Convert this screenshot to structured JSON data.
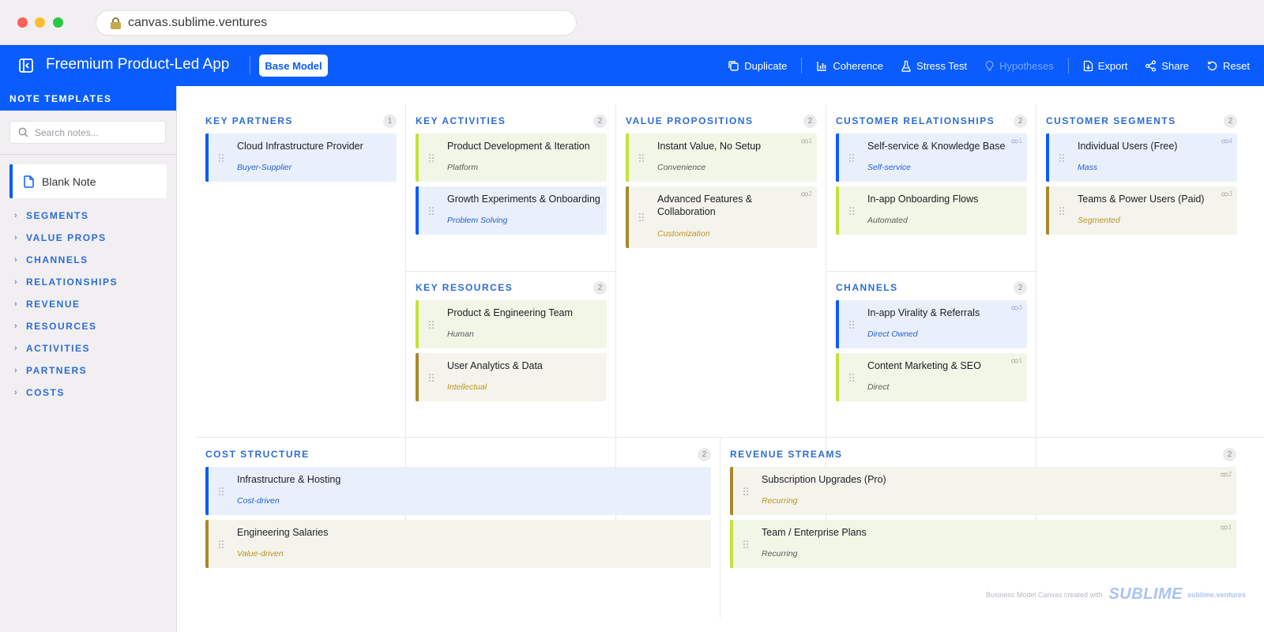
{
  "browser": {
    "url": "canvas.sublime.ventures"
  },
  "header": {
    "title": "Freemium Product-Led App",
    "model_button": "Base Model",
    "actions": [
      {
        "label": "Duplicate",
        "icon": "duplicate-icon",
        "enabled": true
      },
      {
        "label": "Coherence",
        "icon": "bar-chart-icon",
        "enabled": true
      },
      {
        "label": "Stress Test",
        "icon": "flask-icon",
        "enabled": true
      },
      {
        "label": "Hypotheses",
        "icon": "lightbulb-icon",
        "enabled": false
      },
      {
        "label": "Export",
        "icon": "export-icon",
        "enabled": true
      },
      {
        "label": "Share",
        "icon": "share-icon",
        "enabled": true
      },
      {
        "label": "Reset",
        "icon": "reset-icon",
        "enabled": true
      }
    ]
  },
  "sidebar": {
    "title": "NOTE TEMPLATES",
    "search_placeholder": "Search notes...",
    "blank_note": "Blank Note",
    "categories": [
      "SEGMENTS",
      "VALUE PROPS",
      "CHANNELS",
      "RELATIONSHIPS",
      "REVENUE",
      "RESOURCES",
      "ACTIVITIES",
      "PARTNERS",
      "COSTS"
    ]
  },
  "canvas": {
    "key_partners": {
      "title": "KEY PARTNERS",
      "count": "1",
      "notes": [
        {
          "title": "Cloud Infrastructure Provider",
          "tag": "Buyer-Supplier",
          "color": "blue",
          "links": ""
        }
      ]
    },
    "key_activities": {
      "title": "KEY ACTIVITIES",
      "count": "2",
      "notes": [
        {
          "title": "Product Development & Iteration",
          "tag": "Platform",
          "color": "lime",
          "links": ""
        },
        {
          "title": "Growth Experiments & Onboarding",
          "tag": "Problem Solving",
          "color": "blue",
          "links": ""
        }
      ]
    },
    "key_resources": {
      "title": "KEY RESOURCES",
      "count": "2",
      "notes": [
        {
          "title": "Product & Engineering Team",
          "tag": "Human",
          "color": "lime",
          "links": ""
        },
        {
          "title": "User Analytics & Data",
          "tag": "Intellectual",
          "color": "olive",
          "links": ""
        }
      ]
    },
    "value_propositions": {
      "title": "VALUE PROPOSITIONS",
      "count": "2",
      "notes": [
        {
          "title": "Instant Value, No Setup",
          "tag": "Convenience",
          "color": "lime",
          "links": "1"
        },
        {
          "title": "Advanced Features & Collaboration",
          "tag": "Customization",
          "color": "olive",
          "links": "2"
        }
      ]
    },
    "customer_relationships": {
      "title": "CUSTOMER RELATIONSHIPS",
      "count": "2",
      "notes": [
        {
          "title": "Self-service & Knowledge Base",
          "tag": "Self-service",
          "color": "blue",
          "links": "1"
        },
        {
          "title": "In-app Onboarding Flows",
          "tag": "Automated",
          "color": "lime",
          "links": ""
        }
      ]
    },
    "channels": {
      "title": "CHANNELS",
      "count": "2",
      "notes": [
        {
          "title": "In-app Virality & Referrals",
          "tag": "Direct Owned",
          "color": "blue",
          "links": "3"
        },
        {
          "title": "Content Marketing & SEO",
          "tag": "Direct",
          "color": "lime",
          "links": "1"
        }
      ]
    },
    "customer_segments": {
      "title": "CUSTOMER SEGMENTS",
      "count": "2",
      "notes": [
        {
          "title": "Individual Users (Free)",
          "tag": "Mass",
          "color": "blue",
          "links": "4"
        },
        {
          "title": "Teams & Power Users (Paid)",
          "tag": "Segmented",
          "color": "olive",
          "links": "3"
        }
      ]
    },
    "cost_structure": {
      "title": "COST STRUCTURE",
      "count": "2",
      "notes": [
        {
          "title": "Infrastructure & Hosting",
          "tag": "Cost-driven",
          "color": "blue",
          "links": ""
        },
        {
          "title": "Engineering Salaries",
          "tag": "Value-driven",
          "color": "olive",
          "links": ""
        }
      ]
    },
    "revenue_streams": {
      "title": "REVENUE STREAMS",
      "count": "2",
      "notes": [
        {
          "title": "Subscription Upgrades (Pro)",
          "tag": "Recurring",
          "color": "olive",
          "links": "2"
        },
        {
          "title": "Team / Enterprise Plans",
          "tag": "Recurring",
          "color": "lime",
          "links": "1"
        }
      ]
    }
  },
  "footer": {
    "made_with": "Business Model Canvas created with",
    "logo": "SUBLIME",
    "site": "sublime.ventures"
  }
}
